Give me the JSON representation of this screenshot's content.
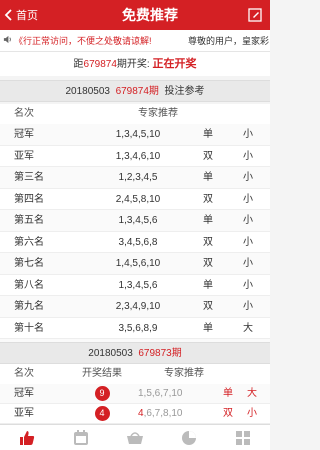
{
  "header": {
    "back_label": "首页",
    "title": "免费推荐"
  },
  "marquee": {
    "text_left": "《行正常访问，不便之处敬请谅解!",
    "text_right": "尊敬的用户，皇家彩"
  },
  "status": {
    "prefix": "距",
    "issue": "679874",
    "middle": "期开奖: ",
    "live": "正在开奖"
  },
  "section1": {
    "date": "20180503",
    "issue": "679874期",
    "suffix": "投注参考",
    "col_name": "名次",
    "col_rec": "专家推荐",
    "rows": [
      {
        "name": "冠军",
        "nums": "1,3,4,5,10",
        "oe": "单",
        "bs": "小"
      },
      {
        "name": "亚军",
        "nums": "1,3,4,6,10",
        "oe": "双",
        "bs": "小"
      },
      {
        "name": "第三名",
        "nums": "1,2,3,4,5",
        "oe": "单",
        "bs": "小"
      },
      {
        "name": "第四名",
        "nums": "2,4,5,8,10",
        "oe": "双",
        "bs": "小"
      },
      {
        "name": "第五名",
        "nums": "1,3,4,5,6",
        "oe": "单",
        "bs": "小"
      },
      {
        "name": "第六名",
        "nums": "3,4,5,6,8",
        "oe": "双",
        "bs": "小"
      },
      {
        "name": "第七名",
        "nums": "1,4,5,6,10",
        "oe": "双",
        "bs": "小"
      },
      {
        "name": "第八名",
        "nums": "1,3,4,5,6",
        "oe": "单",
        "bs": "小"
      },
      {
        "name": "第九名",
        "nums": "2,3,4,9,10",
        "oe": "双",
        "bs": "小"
      },
      {
        "name": "第十名",
        "nums": "3,5,6,8,9",
        "oe": "单",
        "bs": "大"
      },
      {
        "name": "冠亚和",
        "nums": "3,5,6,8,12",
        "oe": "",
        "bs": ""
      }
    ]
  },
  "section2": {
    "date": "20180503",
    "issue": "679873期",
    "col_name": "名次",
    "col_result": "开奖结果",
    "col_rec": "专家推荐",
    "rows": [
      {
        "name": "冠军",
        "result": "9",
        "rec_hit": "",
        "rec_rest": "1,5,6,7,10",
        "oe": "单",
        "bs": "大"
      },
      {
        "name": "亚军",
        "result": "4",
        "rec_hit": "4",
        "rec_rest": ",6,7,8,10",
        "oe": "双",
        "bs": "小"
      }
    ]
  },
  "tabs": [
    "thumbs-up-icon",
    "calendar-icon",
    "basket-icon",
    "pie-chart-icon",
    "grid-icon"
  ],
  "colors": {
    "brand": "#d42024"
  }
}
